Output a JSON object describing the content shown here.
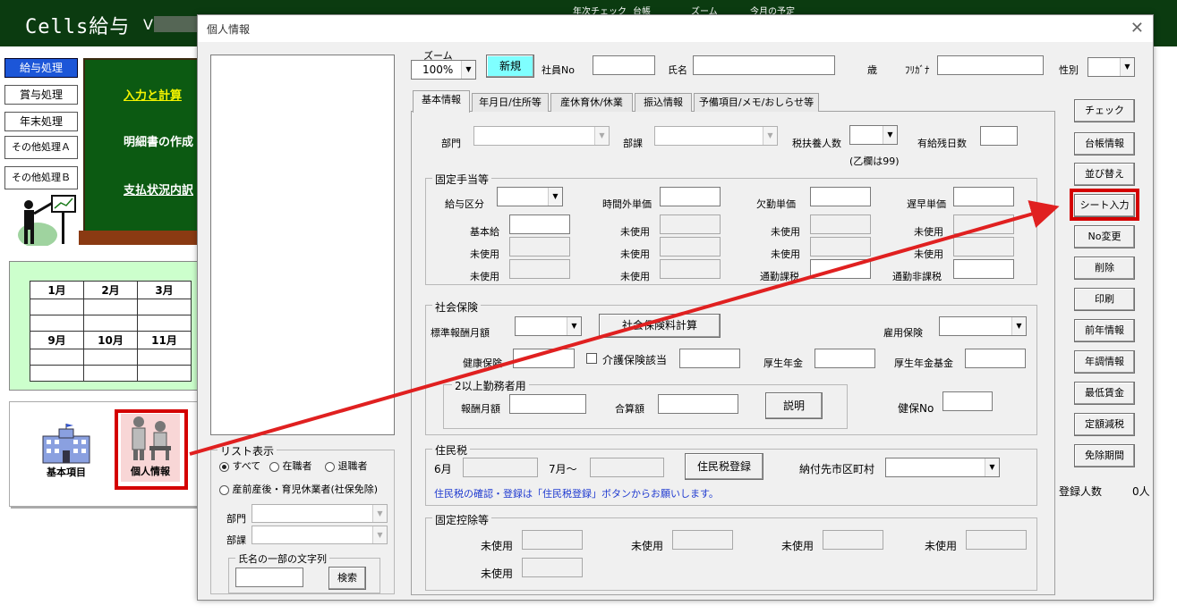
{
  "app": {
    "title": "Cells給与",
    "version": "V",
    "top_menu": {
      "nenji": "年次チェック",
      "daicho": "台帳",
      "zoom": "ズーム",
      "today": "今月の予定"
    },
    "sidebar": [
      "給与処理",
      "賞与処理",
      "年末処理",
      "その他処理Ａ",
      "その他処理Ｂ"
    ],
    "board_links": {
      "input": "入力と計算",
      "meisai": "明細書の作成",
      "shiharai": "支払状況内訳"
    },
    "calendar": {
      "row1": [
        "1月",
        "2月",
        "3月"
      ],
      "row2": [
        "9月",
        "10月",
        "11月"
      ]
    },
    "icons": {
      "kihon": "基本項目",
      "kojin": "個人情報"
    }
  },
  "dialog": {
    "title": "個人情報",
    "zoom_label": "ズーム",
    "zoom_value": "100%",
    "new_button": "新規",
    "header": {
      "shain_no": "社員No",
      "shimei": "氏名",
      "sai": "歳",
      "furigana": "ﾌﾘｶﾞﾅ",
      "seibetsu": "性別"
    },
    "tabs": [
      "基本情報",
      "年月日/住所等",
      "産休育休/休業",
      "振込情報",
      "予備項目/メモ/おしらせ等"
    ],
    "basic": {
      "bumon": "部門",
      "buka": "部課",
      "fuyou": "税扶養人数",
      "fuyou_note": "(乙欄は99)",
      "yukyu": "有給残日数"
    },
    "kotei_teate": {
      "title": "固定手当等",
      "kyuyo_kubun": "給与区分",
      "jikangai": "時間外単価",
      "kekkin": "欠勤単価",
      "chisou": "遅早単価",
      "kihonkyu": "基本給",
      "unused": "未使用",
      "tsukin_kazei": "通勤課税",
      "tsukin_hikazei": "通勤非課税"
    },
    "shakai_hoken": {
      "title": "社会保険",
      "hyoujun": "標準報酬月額",
      "keisan_button": "社会保険料計算",
      "koyou": "雇用保険",
      "kenkou": "健康保険",
      "kaigo": "介護保険該当",
      "kousei": "厚生年金",
      "kousei_kikin": "厚生年金基金",
      "nijou": "2以上勤務者用",
      "houshu": "報酬月額",
      "gassan": "合算額",
      "setsumei_button": "説明",
      "kenpo_no": "健保No"
    },
    "juuminzei": {
      "title": "住民税",
      "june": "6月",
      "july": "7月～",
      "touroku_button": "住民税登録",
      "noufusaki": "納付先市区町村",
      "note": "住民税の確認・登録は「住民税登録」ボタンからお願いします。"
    },
    "kotei_koujo": {
      "title": "固定控除等",
      "unused": "未使用"
    },
    "list_display": {
      "title": "リスト表示",
      "all": "すべて",
      "zaishoku": "在職者",
      "taishoku": "退職者",
      "sanzen": "産前産後・育児休業者(社保免除)",
      "bumon": "部門",
      "buka": "部課",
      "search_title": "氏名の一部の文字列",
      "search_button": "検索"
    },
    "right_buttons": [
      "チェック",
      "台帳情報",
      "並び替え",
      "シート入力",
      "No変更",
      "削除",
      "印刷",
      "前年情報",
      "年調情報",
      "最低賃金",
      "定額減税",
      "免除期間"
    ],
    "registered_label": "登録人数",
    "registered_count": "0人"
  }
}
